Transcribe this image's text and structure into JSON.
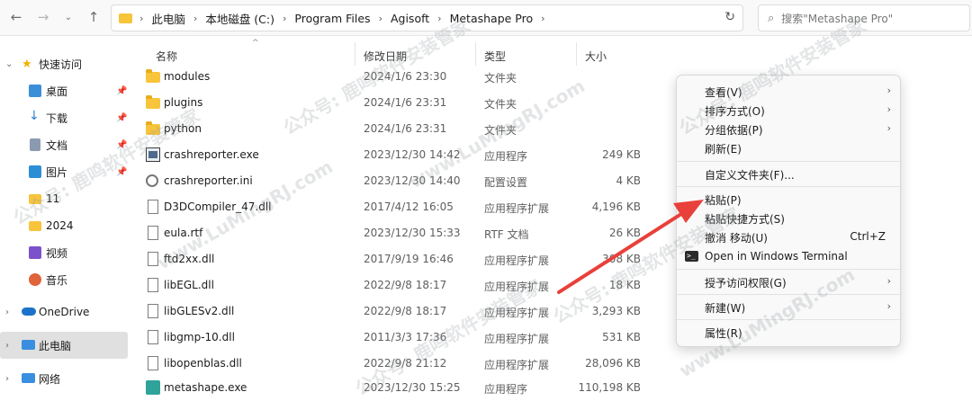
{
  "address": {
    "crumbs": [
      "此电脑",
      "本地磁盘 (C:)",
      "Program Files",
      "Agisoft",
      "Metashape Pro"
    ]
  },
  "search": {
    "placeholder": "搜索\"Metashape Pro\""
  },
  "sidebar": {
    "quick_access": "快速访问",
    "items": [
      {
        "label": "桌面"
      },
      {
        "label": "下载"
      },
      {
        "label": "文档"
      },
      {
        "label": "图片"
      },
      {
        "label": "11"
      },
      {
        "label": "2024"
      },
      {
        "label": "视频"
      },
      {
        "label": "音乐"
      }
    ],
    "onedrive": "OneDrive",
    "this_pc": "此电脑",
    "network": "网络"
  },
  "columns": {
    "name": "名称",
    "date": "修改日期",
    "type": "类型",
    "size": "大小"
  },
  "files": [
    {
      "name": "modules",
      "date": "2024/1/6 23:30",
      "type": "文件夹",
      "size": "",
      "icon": "folder"
    },
    {
      "name": "plugins",
      "date": "2024/1/6 23:31",
      "type": "文件夹",
      "size": "",
      "icon": "folder"
    },
    {
      "name": "python",
      "date": "2024/1/6 23:31",
      "type": "文件夹",
      "size": "",
      "icon": "folder"
    },
    {
      "name": "crashreporter.exe",
      "date": "2023/12/30 14:42",
      "type": "应用程序",
      "size": "249 KB",
      "icon": "exe"
    },
    {
      "name": "crashreporter.ini",
      "date": "2023/12/30 14:40",
      "type": "配置设置",
      "size": "4 KB",
      "icon": "gear"
    },
    {
      "name": "D3DCompiler_47.dll",
      "date": "2017/4/12 16:05",
      "type": "应用程序扩展",
      "size": "4,196 KB",
      "icon": "doc"
    },
    {
      "name": "eula.rtf",
      "date": "2023/12/30 15:33",
      "type": "RTF 文档",
      "size": "26 KB",
      "icon": "doc"
    },
    {
      "name": "ftd2xx.dll",
      "date": "2017/9/19 16:46",
      "type": "应用程序扩展",
      "size": "308 KB",
      "icon": "doc"
    },
    {
      "name": "libEGL.dll",
      "date": "2022/9/8 18:17",
      "type": "应用程序扩展",
      "size": "18 KB",
      "icon": "doc"
    },
    {
      "name": "libGLESv2.dll",
      "date": "2022/9/8 18:17",
      "type": "应用程序扩展",
      "size": "3,293 KB",
      "icon": "doc"
    },
    {
      "name": "libgmp-10.dll",
      "date": "2011/3/3 17:36",
      "type": "应用程序扩展",
      "size": "531 KB",
      "icon": "doc"
    },
    {
      "name": "libopenblas.dll",
      "date": "2022/9/8 21:12",
      "type": "应用程序扩展",
      "size": "28,096 KB",
      "icon": "doc"
    },
    {
      "name": "metashape.exe",
      "date": "2023/12/30 15:25",
      "type": "应用程序",
      "size": "110,198 KB",
      "icon": "app"
    }
  ],
  "context_menu": {
    "view": "查看(V)",
    "sort": "排序方式(O)",
    "group": "分组依据(P)",
    "refresh": "刷新(E)",
    "customize": "自定义文件夹(F)...",
    "paste": "粘贴(P)",
    "paste_shortcut": "粘贴快捷方式(S)",
    "undo": "撤消 移动(U)",
    "undo_key": "Ctrl+Z",
    "terminal": "Open in Windows Terminal",
    "access": "授予访问权限(G)",
    "new": "新建(W)",
    "properties": "属性(R)"
  },
  "watermark": {
    "text": "公众号: 鹿鸣软件安装管家",
    "url": "www.LuMingRJ.com"
  },
  "colors": {
    "accent_red": "#e8403a",
    "folder": "#f7c43b",
    "selected": "#e0e0e0"
  }
}
